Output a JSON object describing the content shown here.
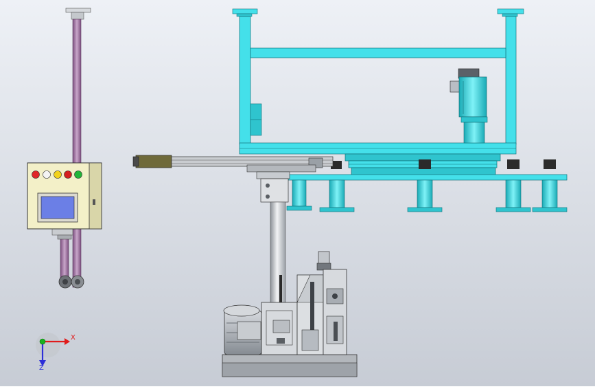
{
  "viewport": {
    "background_top": "#eef1f6",
    "background_bottom": "#c7ccd5"
  },
  "colors": {
    "frame": "#44e0ea",
    "frame_dark": "#1aa7b2",
    "steel": "#c9cdd3",
    "steel_dark": "#7f858c",
    "purple": "#9a6b9d",
    "panel": "#f3f0c8",
    "screen": "#6b7fe6",
    "axis_x": "#e01b1b",
    "axis_y": "#19b31e",
    "axis_z": "#2d2fd8"
  },
  "control_panel": {
    "buttons": [
      "red-stop",
      "white",
      "yellow",
      "red",
      "green"
    ]
  },
  "triad": {
    "x_label": "X",
    "z_label": "Z"
  }
}
